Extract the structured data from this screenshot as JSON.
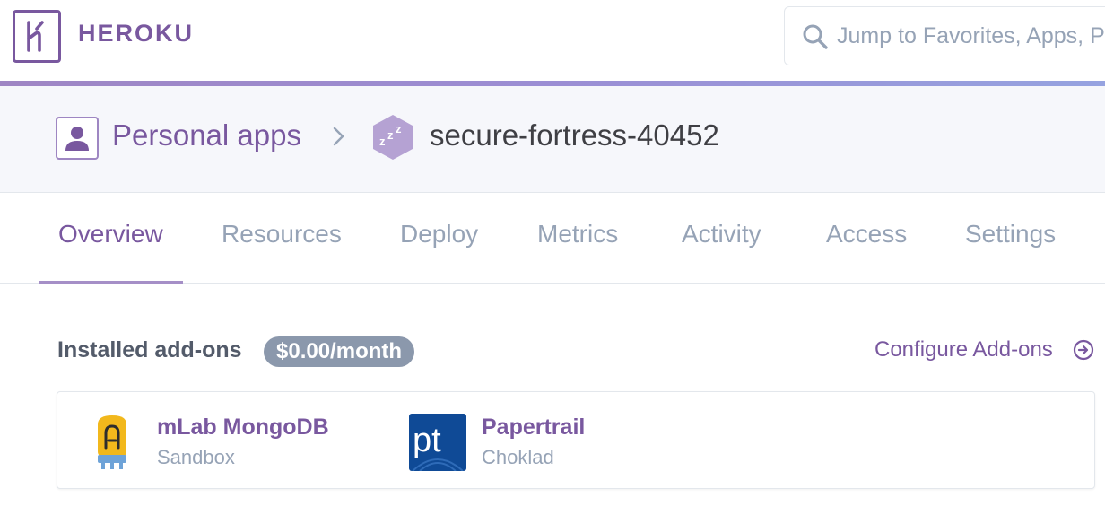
{
  "header": {
    "brand": "HEROKU",
    "search_placeholder": "Jump to Favorites, Apps, Pipelines, Spaces..."
  },
  "breadcrumb": {
    "owner": "Personal apps",
    "app_name": "secure-fortress-40452"
  },
  "tabs": [
    {
      "label": "Overview",
      "active": true
    },
    {
      "label": "Resources",
      "active": false
    },
    {
      "label": "Deploy",
      "active": false
    },
    {
      "label": "Metrics",
      "active": false
    },
    {
      "label": "Activity",
      "active": false
    },
    {
      "label": "Access",
      "active": false
    },
    {
      "label": "Settings",
      "active": false
    }
  ],
  "addons_section": {
    "title": "Installed add-ons",
    "price": "$0.00/month",
    "configure_label": "Configure Add-ons",
    "items": [
      {
        "name": "mLab MongoDB",
        "plan": "Sandbox",
        "icon": "mlab-mongodb-icon"
      },
      {
        "name": "Papertrail",
        "plan": "Choklad",
        "icon": "papertrail-icon"
      }
    ]
  },
  "colors": {
    "brand_purple": "#79589f",
    "muted_gray": "#96a3b6",
    "pill_gray": "#8b98ac",
    "header_band": "#f6f7fb"
  }
}
